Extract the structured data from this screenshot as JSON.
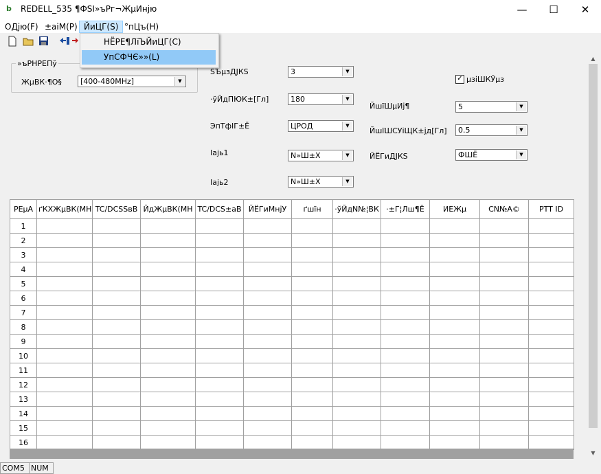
{
  "window": {
    "app_icon_glyph": "b",
    "title": "REDELL_535 ¶ФЅІ»ъРг¬ЖµИнјю"
  },
  "window_controls": {
    "minimize": "—",
    "maximize": "☐",
    "close": "✕"
  },
  "menu": [
    "ОДјю(F)",
    "±аіМ(P)",
    "ЙиЦГ(S)",
    "°пЦъ(H)"
  ],
  "menu_active_index": 2,
  "dropdown": {
    "items": [
      "НЁРЕ¶ЛїЪЙиЦГ(C)",
      "УпСФЧЄ»»(L)"
    ],
    "highlighted_index": 1
  },
  "toolbar_icons": [
    "new-file-icon",
    "open-folder-icon",
    "save-icon",
    "read-device-icon",
    "write-device-icon"
  ],
  "band_group": {
    "legend": "»ъРНРЕПў",
    "label": "ЖµВК·¶О§",
    "value": "[400-480MHz]"
  },
  "settings": {
    "power_save": {
      "label": "ЅЪµзДЈКЅ",
      "value": "3"
    },
    "vox_level": {
      "label": "·ўЙдПЮК±[Гл]",
      "value": "180"
    },
    "scan_mode": {
      "label": "ЭпТфІГ±Ё",
      "value": "ЦРОД"
    },
    "side_key1": {
      "label": "Іаjь1",
      "value": "N»Ш±Х"
    },
    "side_key2": {
      "label": "Іаjь2",
      "value": "N»Ш±Х"
    },
    "beep": {
      "label": "µзіШКЎµз",
      "checked": true
    },
    "squelch": {
      "label": "ЙшїШµИј¶",
      "value": "5"
    },
    "squelch_tail": {
      "label": "ЙшїШСУіЩК±јд[Гл]",
      "value": "0.5"
    },
    "voice": {
      "label": "ЙЁГиДЈКЅ",
      "value": "ФШЁ"
    }
  },
  "table": {
    "columns": [
      "РЕµА",
      "ґКХЖµВК(МН",
      "TC/DCSЅвВ",
      "ЙдЖµВК(МН",
      "TC/DCS±аВ",
      "ЙЁГиМнјУ",
      "ґшїн",
      "·ўЙдN№¦ВК",
      "·±Г¦Лш¶Ё",
      "ИЕЖµ",
      "CN№А©",
      "PTT ID"
    ],
    "rows": [
      "1",
      "2",
      "3",
      "4",
      "5",
      "6",
      "7",
      "8",
      "9",
      "10",
      "11",
      "12",
      "13",
      "14",
      "15",
      "16"
    ]
  },
  "status": {
    "port": "COM5",
    "numlock": "NUM"
  }
}
